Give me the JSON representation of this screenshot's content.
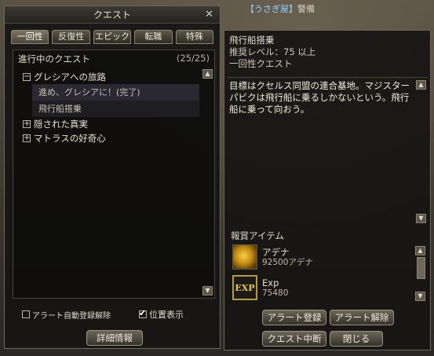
{
  "background": {
    "top_strip": "【うさぎ屋】",
    "top_strip_suffix": "警備"
  },
  "quest_window": {
    "title": "クエスト",
    "tabs": [
      {
        "label": "一回性",
        "active": true
      },
      {
        "label": "反復性",
        "active": false
      },
      {
        "label": "エピック",
        "active": false
      },
      {
        "label": "転職",
        "active": false
      },
      {
        "label": "特殊",
        "active": false
      }
    ],
    "list_header": "進行中のクエスト",
    "count": "(25/25)",
    "quests": [
      {
        "label": "グレシアへの旅路",
        "expanded": true
      },
      {
        "label": "隠された真実",
        "expanded": false
      },
      {
        "label": "マトラスの好奇心",
        "expanded": false
      }
    ],
    "subquests": [
      "進め、グレシアに！(完了)",
      "飛行船搭乗"
    ],
    "options": {
      "auto_alert": {
        "label": "アラート自動登録解除",
        "checked": false
      },
      "show_location": {
        "label": "位置表示",
        "checked": true
      }
    },
    "details_button": "詳細情報"
  },
  "detail_window": {
    "quest_name": "飛行船搭乗",
    "level_label": "推奨レベル：75 以上",
    "type_label": "一回性クエスト",
    "description": "目標はクセルス同盟の連合基地。マジスター パビクは飛行船に乗るしかないという。飛行船に乗って向おう。",
    "reward_title": "報賞アイテム",
    "rewards": [
      {
        "name": "アデナ",
        "value": "92500アデナ",
        "icon": "adena-icon"
      },
      {
        "name": "Exp",
        "value": "75480",
        "icon": "exp-icon",
        "icon_text": "EXP"
      }
    ],
    "buttons": {
      "alert_register": "アラート登録",
      "alert_release": "アラート解除",
      "quest_abort": "クエスト中断",
      "close": "閉じる"
    }
  }
}
